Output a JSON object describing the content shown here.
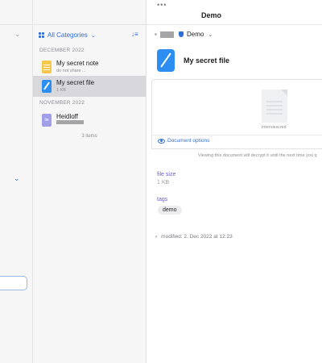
{
  "window": {
    "title": "Demo",
    "more_glyph": "•••"
  },
  "sidebar": {
    "chevron_glyph": "⌄"
  },
  "list": {
    "category_label": "All Categories",
    "category_chevron": "⌄",
    "sort_glyph": "↓≡",
    "sections": [
      {
        "heading": "DECEMBER 2022",
        "items": [
          {
            "name": "My secret note",
            "subtitle": "do not share ...",
            "icon": "note-icon",
            "selected": false
          },
          {
            "name": "My secret file",
            "subtitle": "1 KB",
            "icon": "file-icon",
            "selected": true
          }
        ]
      },
      {
        "heading": "NOVEMBER 2022",
        "items": [
          {
            "name": "Heidloff",
            "subtitle": "",
            "icon": "login-icon",
            "icon_text": "ile",
            "selected": false
          }
        ]
      }
    ],
    "count": "3 items"
  },
  "detail": {
    "vault_name": "Demo",
    "vault_chevron": "⌄",
    "item_title": "My secret file",
    "preview_filename": "interview.md",
    "document_options": "Document options",
    "notice": "Viewing this document will decrypt it until the next time you q",
    "fields": [
      {
        "label": "file size",
        "value": "1 KB"
      }
    ],
    "tags_label": "tags",
    "tags": [
      "demo"
    ],
    "disclosure_glyph": "›",
    "modified": "modified: 2. Dec 2022 at 12:23"
  },
  "colors": {
    "accent": "#2f6fd8",
    "field_label": "#6f5cd6",
    "selected_row": "#d8d8dc"
  }
}
